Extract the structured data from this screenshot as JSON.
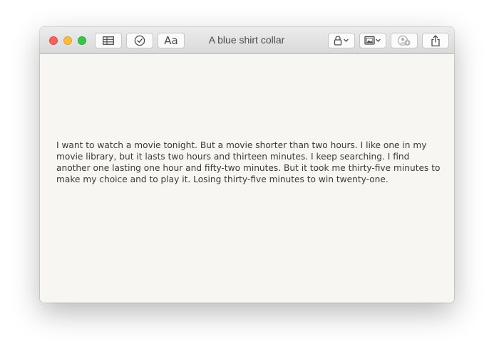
{
  "window": {
    "title": "A blue shirt collar"
  },
  "toolbar": {
    "left_buttons": [
      {
        "icon": "table-icon"
      },
      {
        "icon": "checklist-icon"
      },
      {
        "icon": "format-icon",
        "label": "Aa"
      }
    ],
    "right_buttons": [
      {
        "icon": "lock-icon"
      },
      {
        "icon": "media-icon"
      },
      {
        "icon": "collaborate-icon"
      },
      {
        "icon": "share-icon"
      }
    ]
  },
  "note": {
    "body": "I want to watch a movie tonight. But a movie shorter than two hours. I like one in my movie library, but it lasts two hours and thirteen minutes. I keep searching. I find another one lasting one hour and fifty-two minutes. But it took me thirty-five minutes to make my choice and to play it. Losing thirty-five minutes to win twenty-one."
  },
  "colors": {
    "close": "#fc605c",
    "minimize": "#fdbc40",
    "zoom": "#34c84a",
    "paper": "#f7f6f3"
  }
}
